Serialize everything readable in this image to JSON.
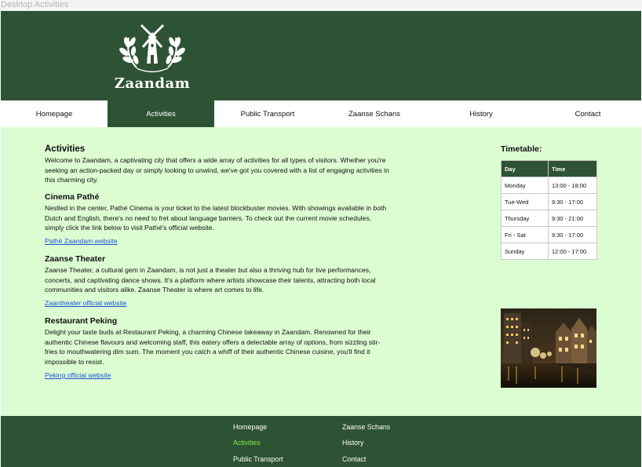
{
  "window": {
    "title": "Desktop Activities"
  },
  "brand": {
    "name": "Zaandam",
    "logo_icon": "windmill-wreath-icon"
  },
  "nav": {
    "items": [
      {
        "label": "Homepage",
        "active": false
      },
      {
        "label": "Activities",
        "active": true
      },
      {
        "label": "Public Transport",
        "active": false
      },
      {
        "label": "Zaanse Schans",
        "active": false
      },
      {
        "label": "History",
        "active": false
      },
      {
        "label": "Contact",
        "active": false
      }
    ]
  },
  "content": {
    "title": "Activities",
    "intro": "Welcome to Zaandam, a captivating city that offers a wide array of activities for all types of visitors. Whether you're seeking an action-packed day or simply looking to unwind, we've got you covered with a list of engaging activities in this charming city.",
    "sections": [
      {
        "heading": "Cinema Pathé",
        "text": "Nestled in the center, Pathé Cinema is your ticket to the latest blockbuster movies. With showings available in both Dutch and English, there's no need to fret about language barriers. To check out the current movie schedules, simply click the link below to visit Pathé's official website.",
        "link": "Pathé Zaandam website"
      },
      {
        "heading": "Zaanse Theater",
        "text": "Zaanse Theater, a cultural gem in Zaandam, is not just a theater but also a thriving hub for live performances, concerts, and captivating dance shows. It's a platform where artists showcase their talents, attracting both local communities and visitors alike. Zaanse Theater is where art comes to life.",
        "link": "Zaantheater official website"
      },
      {
        "heading": "Restaurant Peking",
        "text": "Delight your taste buds at Restaurant Peking, a charming Chinese takeaway in Zaandam. Renowned for their authentic Chinese flavours and welcoming staff, this eatery offers a delectable array of options, from sizzling stir-fries to mouthwatering dim sum. The moment you catch a whiff of their authentic Chinese cuisine, you'll find it impossible to resist.",
        "link": "Peking official website"
      }
    ]
  },
  "timetable": {
    "title": "Timetable:",
    "headers": [
      "Day",
      "Time"
    ],
    "rows": [
      [
        "Monday",
        "13:00 - 18:00"
      ],
      [
        "Tue-Wed",
        "9:30 - 17:00"
      ],
      [
        "Thursday",
        "9:30 - 21:00"
      ],
      [
        "Fri - Sat",
        "9:30 - 17:00"
      ],
      [
        "Sunday",
        "12:00 - 17:00"
      ]
    ]
  },
  "footer": {
    "links": [
      {
        "label": "Homepage",
        "active": false
      },
      {
        "label": "Activities",
        "active": true
      },
      {
        "label": "Public Transport",
        "active": false
      },
      {
        "label": "Zaanse Schans",
        "active": false
      },
      {
        "label": "History",
        "active": false
      },
      {
        "label": "Contact",
        "active": false
      }
    ]
  },
  "colors": {
    "brand_green": "#2d5234",
    "content_bg": "#dcfcd1",
    "link_blue": "#1a55d8",
    "footer_active": "#88e84a"
  }
}
